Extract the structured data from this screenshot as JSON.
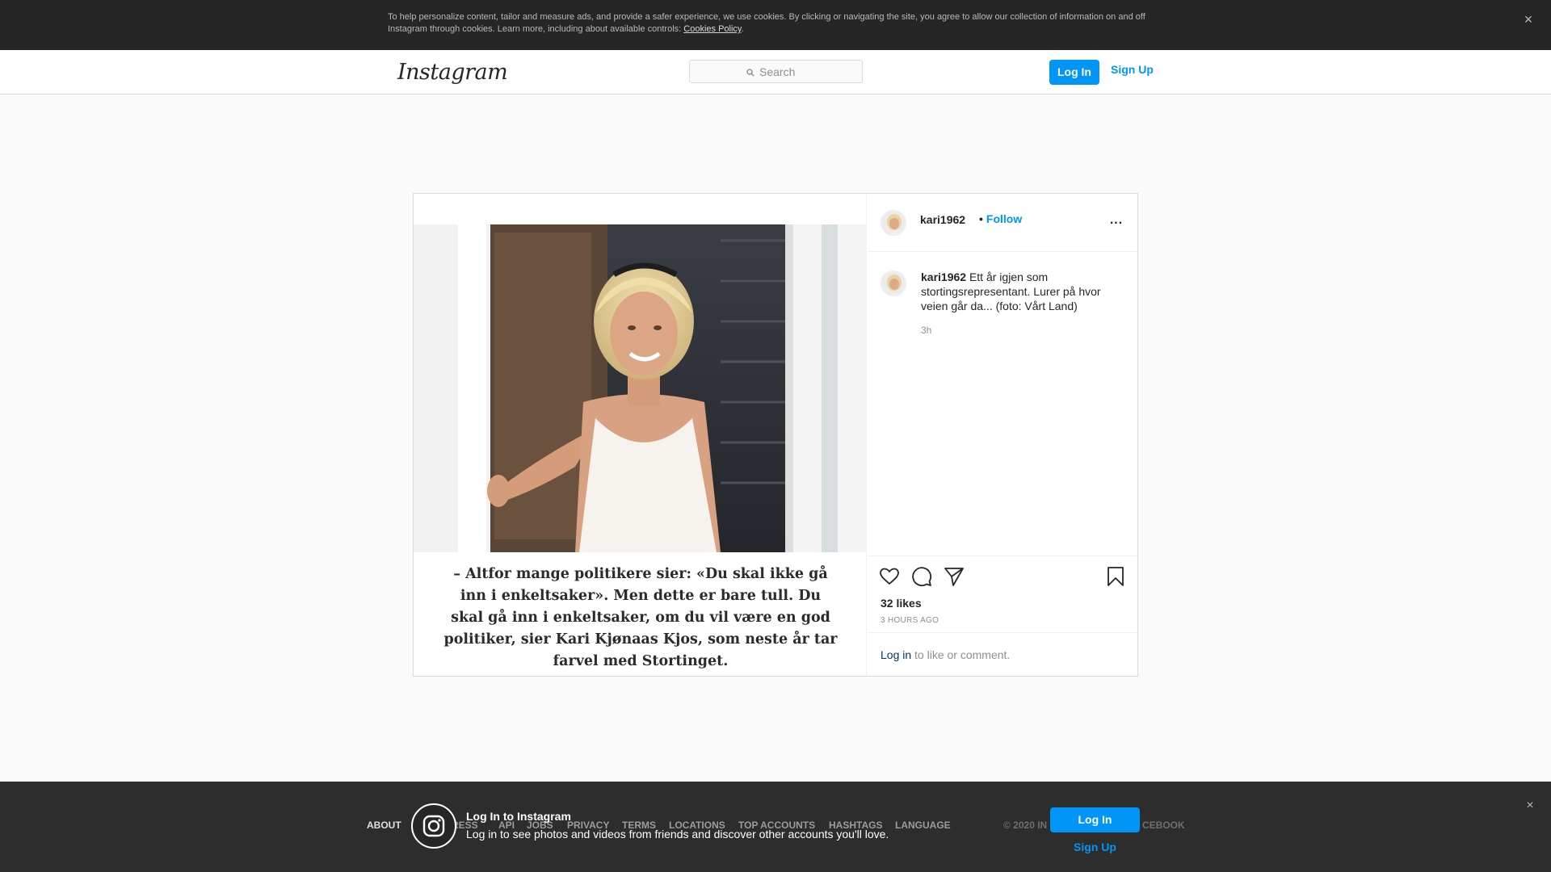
{
  "cookie_banner": {
    "text": "To help personalize content, tailor and measure ads, and provide a safer experience, we use cookies. By clicking or navigating the site, you agree to allow our collection of information on and off Instagram through cookies. Learn more, including about available controls: ",
    "link": "Cookies Policy",
    "close": "×"
  },
  "header": {
    "logo": "Instagram",
    "search_placeholder": "Search",
    "login": "Log In",
    "signup": "Sign Up"
  },
  "post": {
    "username": "kari1962",
    "follow_sep": "•",
    "follow": "Follow",
    "more": "...",
    "caption_user": "kari1962",
    "caption_text": "Ett år igjen som stortingsrepresentant. Lurer på hvor veien går da... (foto: Vårt Land)",
    "caption_time": "3h",
    "image_quote": "– Altfor mange politikere sier: «Du skal ikke gå inn i enkeltsaker». Men dette er bare tull. Du skal gå inn i enkeltsaker, om du vil være en god politiker, sier Kari Kjønaas Kjos, som neste år tar farvel med Stortinget.",
    "likes": "32 likes",
    "posted": "3 HOURS AGO",
    "comment_login": "Log in",
    "comment_rest": " to like or comment."
  },
  "footer": {
    "links_left": [
      "ABOUT"
    ],
    "links_visible": [
      "RESS",
      "API",
      "JOBS",
      "PRIVACY",
      "TERMS",
      "LOCATIONS",
      "TOP ACCOUNTS",
      "HASHTAGS",
      "LANGUAGE"
    ],
    "copy_left": "© 2020 IN",
    "copy_right": "CEBOOK"
  },
  "bottom_banner": {
    "title": "Log In to Instagram",
    "subtitle": "Log in to see photos and videos from friends and discover other accounts you'll love.",
    "login": "Log In",
    "signup": "Sign Up",
    "close": "×"
  },
  "colors": {
    "accent": "#0095f6",
    "banner_bg": "#262626"
  }
}
